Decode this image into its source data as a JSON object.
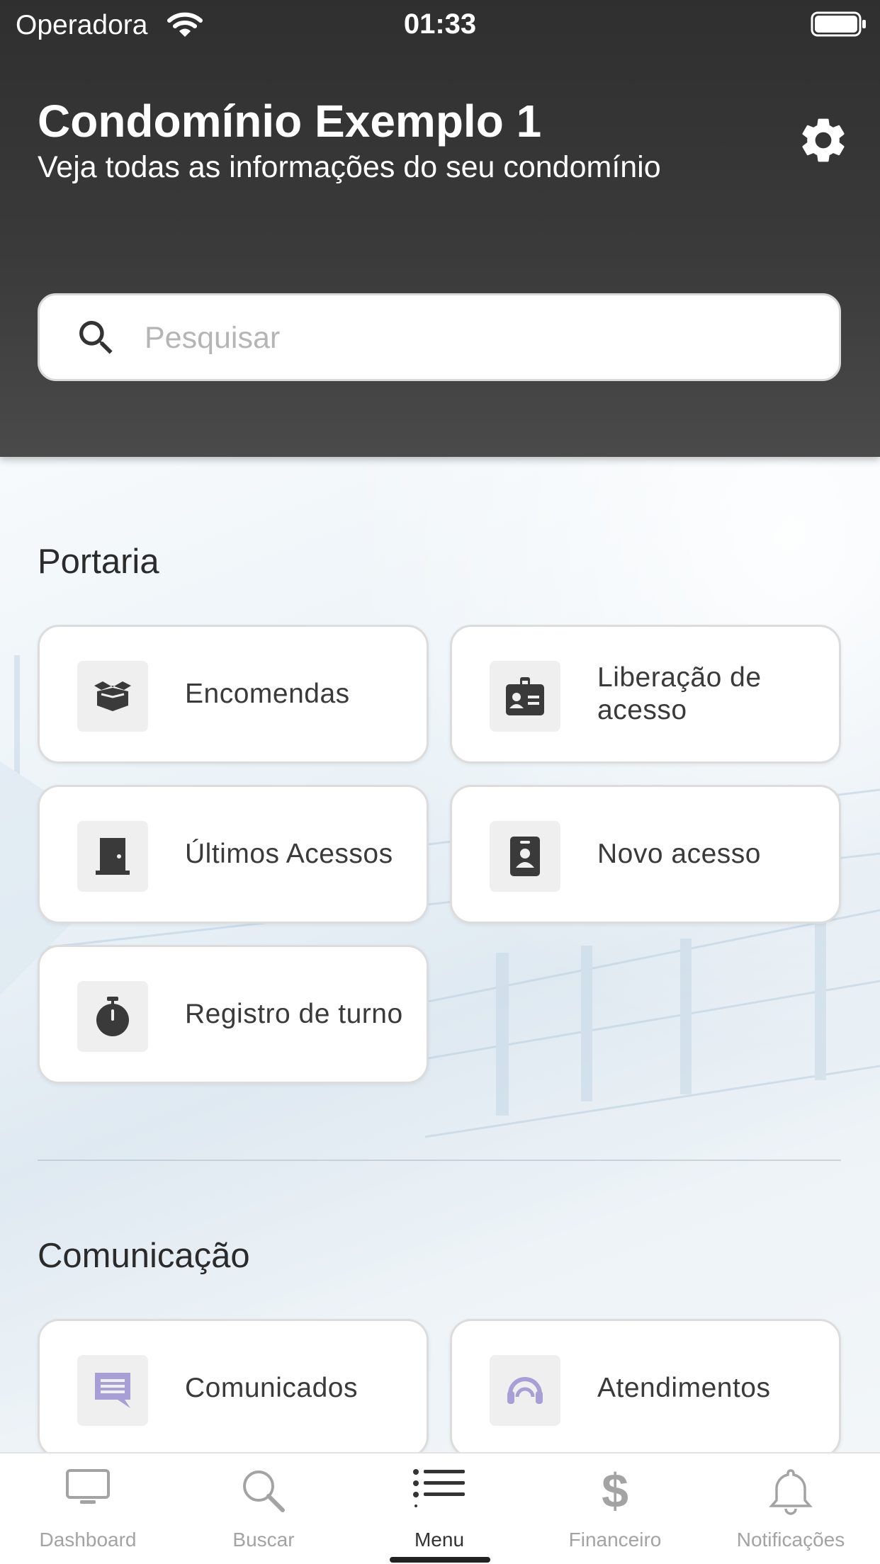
{
  "status": {
    "carrier": "Operadora",
    "time": "01:33"
  },
  "header": {
    "title": "Condomínio Exemplo 1",
    "subtitle": "Veja todas as informações do seu condomínio",
    "settings_icon": "gear-icon"
  },
  "search": {
    "placeholder": "Pesquisar",
    "value": "",
    "icon": "search-icon"
  },
  "sections": [
    {
      "title": "Portaria",
      "items": [
        {
          "label": "Encomendas",
          "icon": "package-icon"
        },
        {
          "label": "Liberação de acesso",
          "icon": "id-badge-icon"
        },
        {
          "label": "Últimos Acessos",
          "icon": "door-icon"
        },
        {
          "label": "Novo acesso",
          "icon": "contact-card-icon"
        },
        {
          "label": "Registro de turno",
          "icon": "stopwatch-icon"
        }
      ]
    },
    {
      "title": "Comunicação",
      "items": [
        {
          "label": "Comunicados",
          "icon": "message-icon"
        },
        {
          "label": "Atendimentos",
          "icon": "headset-icon"
        }
      ]
    }
  ],
  "tabs": [
    {
      "label": "Dashboard",
      "icon": "monitor-icon",
      "active": false
    },
    {
      "label": "Buscar",
      "icon": "search-icon",
      "active": false
    },
    {
      "label": "Menu",
      "icon": "list-icon",
      "active": true
    },
    {
      "label": "Financeiro",
      "icon": "dollar-icon",
      "active": false
    },
    {
      "label": "Notificações",
      "icon": "bell-icon",
      "active": false
    }
  ],
  "colors": {
    "header_bg": "#333333",
    "icon_dark": "#3a3a3a",
    "icon_accent": "#a89fd6",
    "tab_inactive": "#a3a3a3"
  }
}
